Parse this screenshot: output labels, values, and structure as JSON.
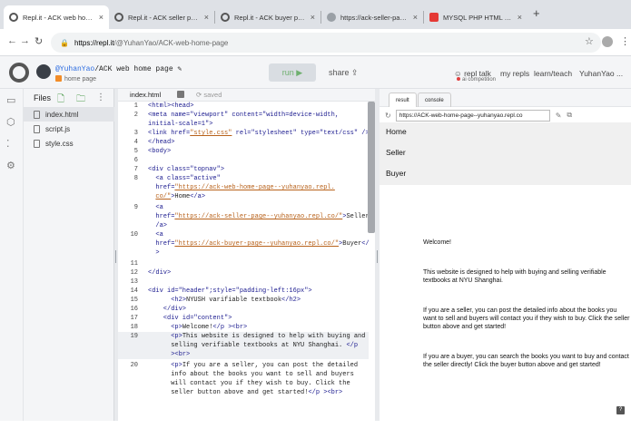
{
  "browser": {
    "tabs": [
      {
        "title": "Repl.it - ACK web home page",
        "color": "#5f6368"
      },
      {
        "title": "Repl.it - ACK seller page",
        "color": "#5f6368"
      },
      {
        "title": "Repl.it - ACK buyer page",
        "color": "#5f6368"
      },
      {
        "title": "https://ack-seller-page--yuha",
        "color": "#9aa0a6"
      },
      {
        "title": "MYSQL PHP HTML Forum tuto",
        "color": "#e53935"
      }
    ],
    "url_host": "https://repl.it",
    "url_path": "/@YuhanYao/ACK-web-home-page"
  },
  "repl": {
    "user": "@YuhanYao",
    "title_rest": "/ACK web home page",
    "sub": "home page",
    "run_label": "run ▶",
    "share_label": "share",
    "nav": [
      "repl talk",
      "my repls",
      "learn/teach",
      "YuhanYao ..."
    ],
    "talk_sub": "ai competition"
  },
  "files": {
    "title": "Files",
    "items": [
      "index.html",
      "script.js",
      "style.css"
    ]
  },
  "editor": {
    "tab": "index.html",
    "saved": "saved"
  },
  "output": {
    "tabs": [
      "result",
      "console"
    ],
    "url": "https://ACK-web-home-page--yuhanyao.repl.co",
    "nav": [
      "Home",
      "Seller",
      "Buyer"
    ],
    "welcome": "Welcome!",
    "p1": "This website is designed to help with buying and selling verifiable textbooks at NYU Shanghai.",
    "p2": "If you are a seller, you can post the detailed info about the books you want to sell and buyers will contact you if they wish to buy. Click the seller button above and get started!",
    "p3": "If you are a buyer, you can search the books you want to buy and contact the seller directly! Click the buyer button above and get started!",
    "help": "?"
  }
}
